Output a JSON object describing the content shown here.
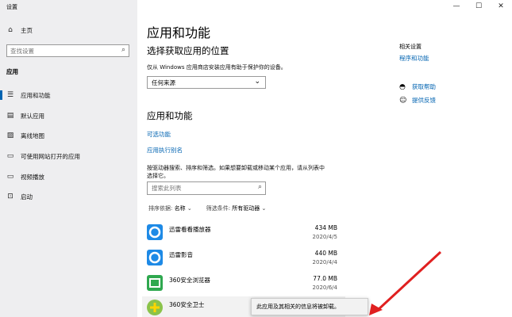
{
  "window": {
    "title": "设置",
    "minimize": "—",
    "maximize": "☐",
    "close": "✕"
  },
  "sidebar": {
    "home": {
      "icon": "home-icon",
      "label": "主页"
    },
    "search_placeholder": "查找设置",
    "section": "应用",
    "items": [
      {
        "icon": "list-icon",
        "label": "应用和功能"
      },
      {
        "icon": "default-apps-icon",
        "label": "默认应用"
      },
      {
        "icon": "map-icon",
        "label": "离线地图"
      },
      {
        "icon": "web-icon",
        "label": "可使用网站打开的应用"
      },
      {
        "icon": "video-icon",
        "label": "视频播放"
      },
      {
        "icon": "startup-icon",
        "label": "启动"
      }
    ]
  },
  "main": {
    "title": "应用和功能",
    "install_heading": "选择获取应用的位置",
    "install_desc": "仅从 Windows 应用商店安装应用有助于保护你的设备。",
    "install_select": "任何来源",
    "apps_heading": "应用和功能",
    "optional_link": "可选功能",
    "alias_link": "应用执行别名",
    "search_desc_1": "按驱动器搜索、排序和筛选。如果想要卸载或移动某个应用，请从列表中",
    "search_desc_2": "选择它。",
    "search_placeholder": "搜索此列表",
    "sort_label": "排序依据:",
    "sort_value": "名称",
    "filter_label": "筛选条件:",
    "filter_value": "所有驱动器",
    "apps": [
      {
        "name": "迅雷看看播放器",
        "size": "434 MB",
        "date": "2020/4/5",
        "color": "#1e8ae6"
      },
      {
        "name": "迅雷影音",
        "size": "440 MB",
        "date": "2020/4/4",
        "color": "#1e8ae6"
      },
      {
        "name": "360安全浏览器",
        "size": "77.0 MB",
        "date": "2020/6/4",
        "color": "#2fa84f"
      },
      {
        "name": "360安全卫士",
        "size": "",
        "date": "",
        "color": "#4caf50"
      }
    ],
    "tooltip": "此应用及其相关的信息将被卸载。"
  },
  "related": {
    "title": "相关设置",
    "link": "程序和功能",
    "help": "获取帮助",
    "feedback": "提供反馈"
  },
  "colors": {
    "accent": "#0063b1",
    "arrow": "#e02020"
  }
}
